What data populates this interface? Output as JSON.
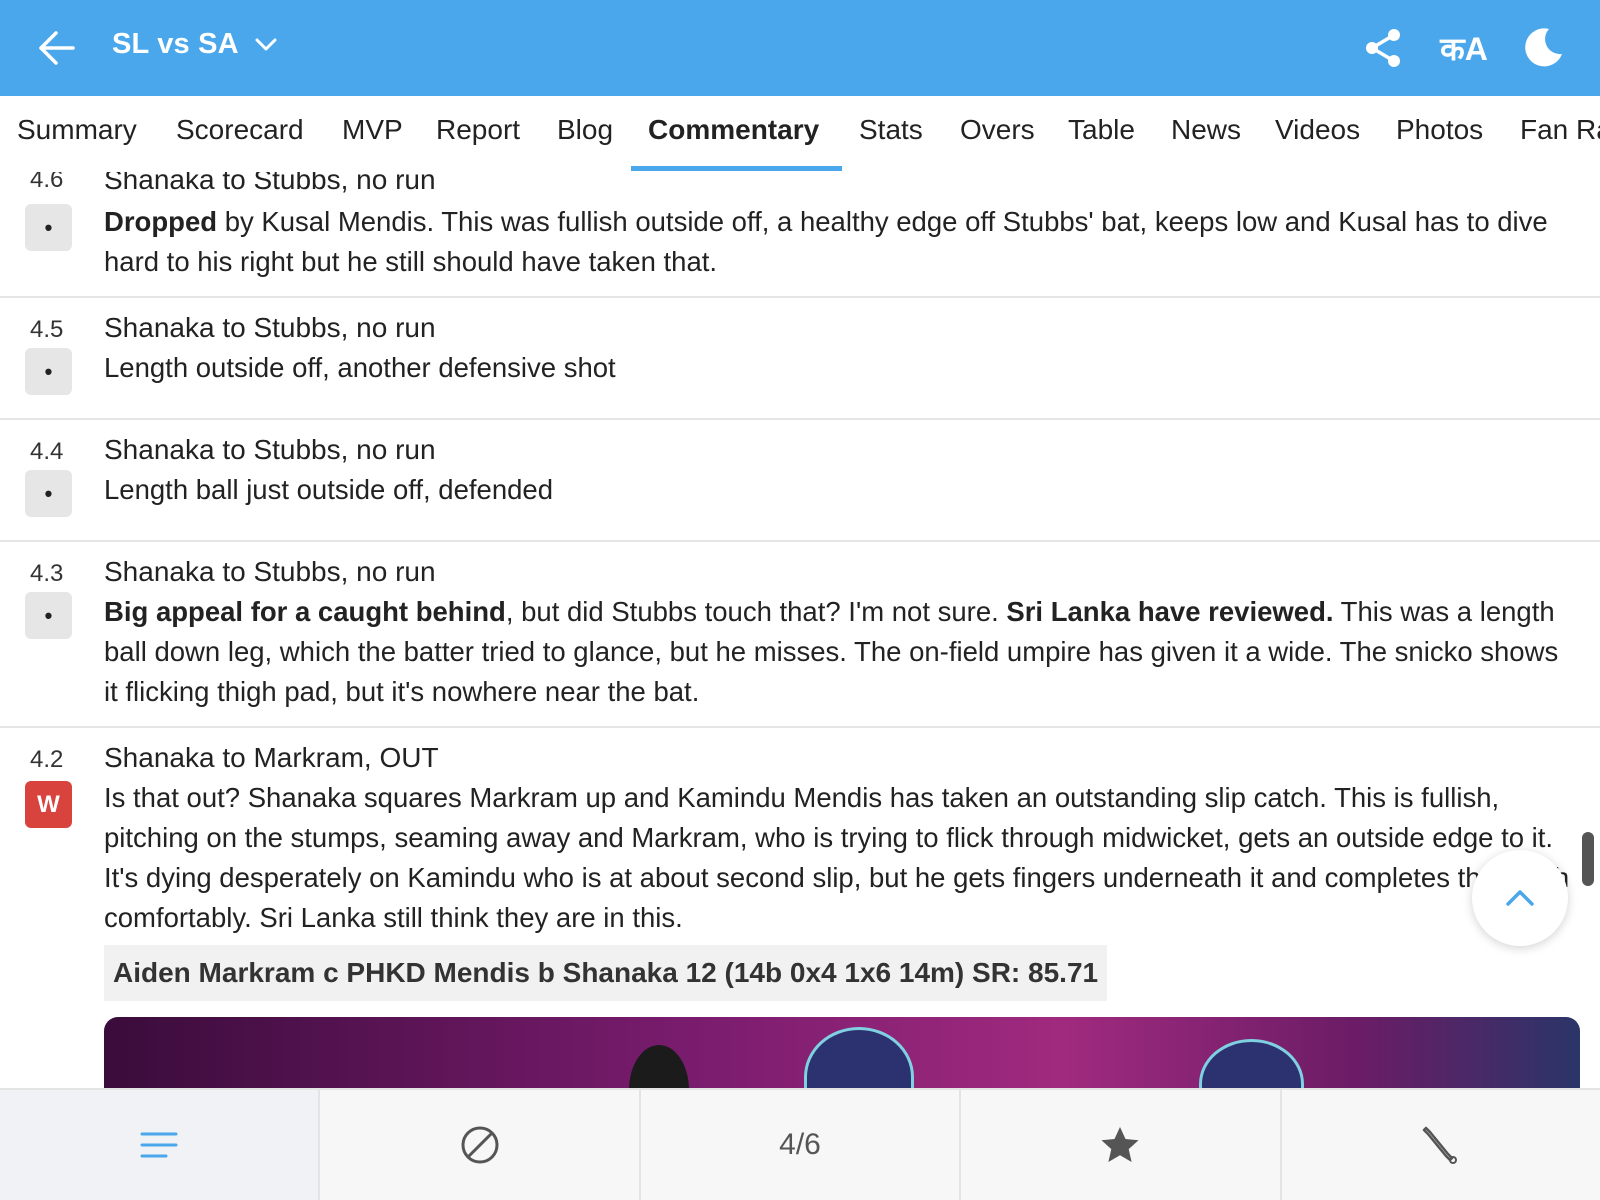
{
  "header": {
    "title": "SL vs SA",
    "language_label": "कA",
    "icons": {
      "back": "arrow-left-icon",
      "dropdown": "chevron-down-icon",
      "share": "share-icon",
      "language": "language-icon",
      "theme": "moon-icon"
    }
  },
  "tabs": [
    {
      "label": "Summary"
    },
    {
      "label": "Scorecard"
    },
    {
      "label": "MVP"
    },
    {
      "label": "Report"
    },
    {
      "label": "Blog"
    },
    {
      "label": "Commentary",
      "active": true
    },
    {
      "label": "Stats"
    },
    {
      "label": "Overs"
    },
    {
      "label": "Table"
    },
    {
      "label": "News"
    },
    {
      "label": "Videos"
    },
    {
      "label": "Photos"
    },
    {
      "label": "Fan Ra"
    }
  ],
  "commentary": [
    {
      "over": "4.6",
      "result": "•",
      "headline": "Shanaka to Stubbs, no run",
      "bold_lead": "Dropped",
      "text": " by Kusal Mendis. This was fullish outside off, a healthy edge off Stubbs' bat, keeps low and Kusal has to dive hard to his right but he still should have taken that."
    },
    {
      "over": "4.5",
      "result": "•",
      "headline": "Shanaka to Stubbs, no run",
      "text": "Length outside off, another defensive shot"
    },
    {
      "over": "4.4",
      "result": "•",
      "headline": "Shanaka to Stubbs, no run",
      "text": "Length ball just outside off, defended"
    },
    {
      "over": "4.3",
      "result": "•",
      "headline": "Shanaka to Stubbs, no run",
      "bold_lead": "Big appeal for a caught behind",
      "text_part1": ", but did Stubbs touch that? I'm not sure. ",
      "bold_mid": "Sri Lanka have reviewed.",
      "text_part2": " This was a length ball down leg, which the batter tried to glance, but he misses. The on-field umpire has given it a wide. The snicko shows it flicking thigh pad, but it's nowhere near the bat."
    },
    {
      "over": "4.2",
      "result": "W",
      "headline": "Shanaka to Markram, OUT",
      "text": "Is that out? Shanaka squares Markram up and Kamindu Mendis has taken an outstanding slip catch. This is fullish, pitching on the stumps, seaming away and Markram, who is trying to flick through midwicket, gets an outside edge to it. It's dying desperately on Kamindu who is at about second slip, but he gets fingers underneath it and completes the catch comfortably. Sri Lanka still think they are in this.",
      "dismissal": "Aiden Markram c PHKD Mendis b Shanaka 12 (14b 0x4 1x6 14m) SR: 85.71"
    }
  ],
  "bottom_bar": {
    "items": [
      {
        "icon": "menu-lines-icon",
        "active": true
      },
      {
        "icon": "cricket-ball-icon"
      },
      {
        "label": "4/6"
      },
      {
        "icon": "star-icon"
      },
      {
        "icon": "cricket-bat-icon"
      }
    ]
  },
  "colors": {
    "brand": "#4ba7ec",
    "wicket": "#d9433d",
    "dot_badge": "#e6e6e6"
  }
}
